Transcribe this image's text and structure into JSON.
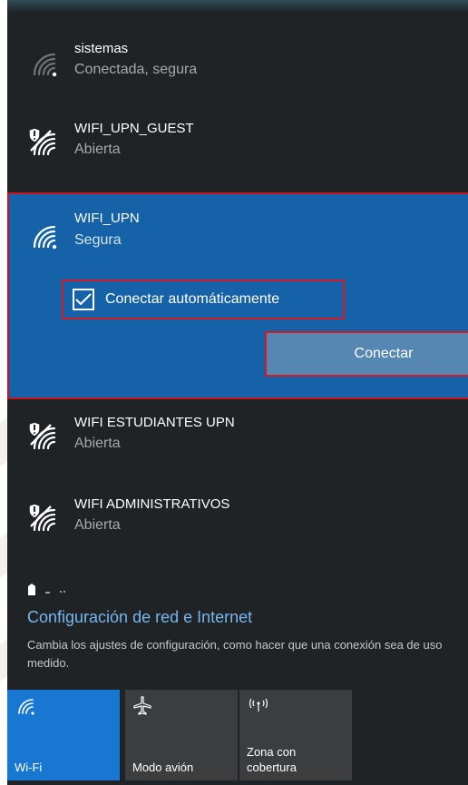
{
  "networks": [
    {
      "name": "sistemas",
      "status": "Conectada, segura",
      "icon": "wifi-icon"
    },
    {
      "name": "WIFI_UPN_GUEST",
      "status": "Abierta",
      "icon": "wifi-shield-icon"
    },
    {
      "name": "WIFI_UPN",
      "status": "Segura",
      "icon": "wifi-icon"
    },
    {
      "name": "WIFI ESTUDIANTES UPN",
      "status": "Abierta",
      "icon": "wifi-shield-icon"
    },
    {
      "name": "WIFI ADMINISTRATIVOS",
      "status": "Abierta",
      "icon": "wifi-shield-icon"
    }
  ],
  "selected_network": {
    "auto_connect_label": "Conectar automáticamente",
    "auto_connect_checked": true,
    "connect_button": "Conectar"
  },
  "settings": {
    "title": "Configuración de red e Internet",
    "description": "Cambia los ajustes de configuración, como hacer que una conexión sea de uso medido."
  },
  "quick_actions": [
    {
      "label": "Wi-Fi",
      "icon": "wifi-icon",
      "active": true
    },
    {
      "label": "Modo avión",
      "icon": "airplane-icon",
      "active": false
    },
    {
      "label": "Zona con cobertura",
      "label_line1": "Zona con",
      "label_line2": "cobertura",
      "icon": "hotspot-icon",
      "active": false
    }
  ],
  "colors": {
    "flyout_bg": "#1f2326",
    "selected_bg": "#1562a8",
    "connect_button_bg": "#5686b2",
    "highlight_border": "#d11a21",
    "link_color": "#76b6ee",
    "active_tile": "#1878d1",
    "tile_bg": "#3b3d3f"
  }
}
